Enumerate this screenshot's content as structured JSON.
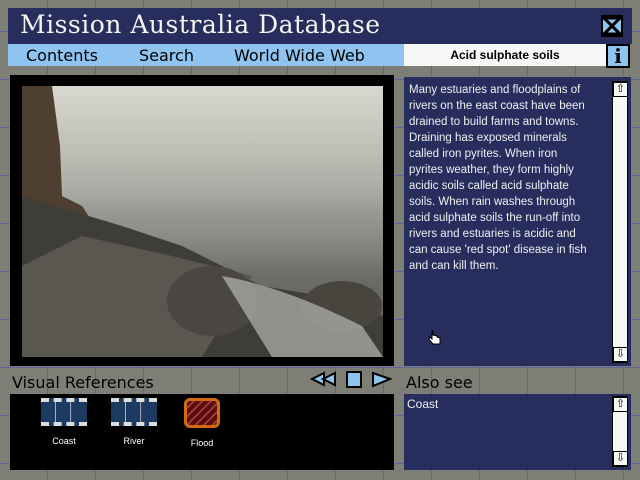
{
  "header": {
    "title": "Mission Australia Database",
    "close_icon": "close-icon"
  },
  "nav": {
    "contents": "Contents",
    "search": "Search",
    "www": "World Wide Web",
    "topic": "Acid sulphate soils",
    "info": "i"
  },
  "article": {
    "lines": [
      "Many estuaries and floodplains of",
      "rivers on the east coast have been",
      "drained to build farms and towns.",
      "Draining has exposed minerals",
      "called iron pyrites.  When iron",
      "pyrites weather, they form highly",
      "acidic soils called acid sulphate",
      "soils.  When rain washes through",
      "acid sulphate soils the run-off into",
      "rivers and estuaries is acidic and",
      "can cause 'red spot' disease in fish",
      "and can kill them."
    ]
  },
  "visual_refs": {
    "label": "Visual References",
    "items": [
      {
        "label": "Coast",
        "icon": "film-icon"
      },
      {
        "label": "River",
        "icon": "film-icon"
      },
      {
        "label": "Flood",
        "icon": "image-icon"
      }
    ]
  },
  "also_see": {
    "label": "Also see",
    "items": [
      "Coast"
    ]
  },
  "colors": {
    "navy": "#272d5d",
    "light_blue": "#8fc4f0",
    "background": "#7d7f77"
  }
}
